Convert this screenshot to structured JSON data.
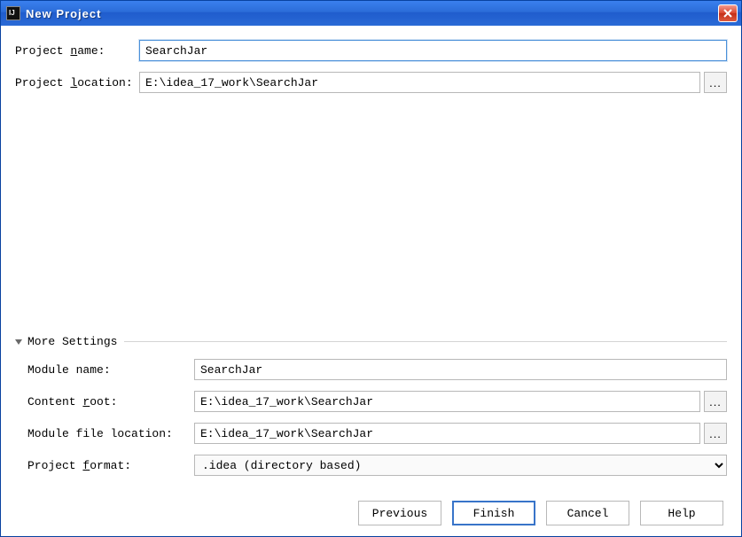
{
  "window": {
    "title": "New Project"
  },
  "form": {
    "project_name_label_pre": "Project ",
    "project_name_label_u": "n",
    "project_name_label_post": "ame:",
    "project_name_value": "SearchJar",
    "project_location_label_pre": "Project ",
    "project_location_label_u": "l",
    "project_location_label_post": "ocation:",
    "project_location_value": "E:\\idea_17_work\\SearchJar",
    "browse_ellipsis": "..."
  },
  "more": {
    "header": "More Settings",
    "module_name_label": "Module name:",
    "module_name_value": "SearchJar",
    "content_root_label_pre": "Content ",
    "content_root_label_u": "r",
    "content_root_label_post": "oot:",
    "content_root_value": "E:\\idea_17_work\\SearchJar",
    "module_file_loc_label": "Module file location:",
    "module_file_loc_value": "E:\\idea_17_work\\SearchJar",
    "project_format_label_pre": "Project ",
    "project_format_label_u": "f",
    "project_format_label_post": "ormat:",
    "project_format_value": ".idea (directory based)"
  },
  "buttons": {
    "previous": "Previous",
    "finish": "Finish",
    "cancel": "Cancel",
    "help": "Help"
  }
}
